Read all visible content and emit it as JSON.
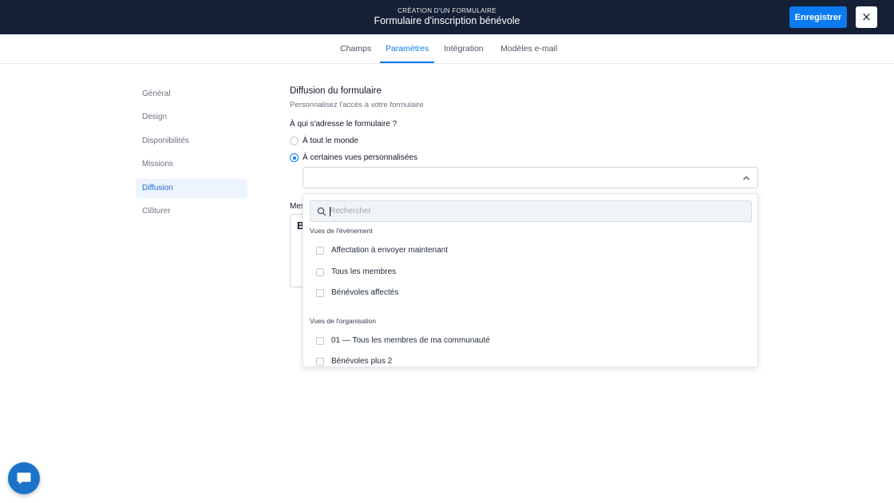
{
  "header": {
    "supertitle": "CRÉATION D'UN FORMULAIRE",
    "title": "Formulaire d'inscription bénévole",
    "save_label": "Enregistrer",
    "close_icon": "×",
    "bg_color": "#152036",
    "accent": "#0b7bf1"
  },
  "tabs": [
    {
      "label": "Champs",
      "active": false
    },
    {
      "label": "Paramètres",
      "active": true
    },
    {
      "label": "Intégration",
      "active": false
    },
    {
      "label": "Modèles e-mail",
      "active": false
    }
  ],
  "sidebar": {
    "items": [
      {
        "label": "Général",
        "active": false
      },
      {
        "label": "Design",
        "active": false
      },
      {
        "label": "Disponibilités",
        "active": false
      },
      {
        "label": "Missions",
        "active": false
      },
      {
        "label": "Diffusion",
        "active": true
      },
      {
        "label": "Clôturer",
        "active": false
      }
    ]
  },
  "section": {
    "title": "Diffusion du formulaire",
    "subtitle": "Personnalisez l'accès à votre formulaire",
    "question": "À qui s'adresse le formulaire ?",
    "options": [
      {
        "label": "À tout le monde",
        "checked": false
      },
      {
        "label": "À certaines vues personnalisées",
        "checked": true
      }
    ],
    "partial_label_behind": "Mes",
    "partial_editor_glyph": "B"
  },
  "dropdown": {
    "search_placeholder": "Rechercher",
    "groups": [
      {
        "title": "Vues de l'événement",
        "items": [
          "Affectation à envoyer maintenant",
          "Tous les membres",
          "Bénévoles affectés"
        ]
      },
      {
        "title": "Vues de l'organisation",
        "items": [
          "01 — Tous les membres de ma communauté",
          "Bénévoles plus 2"
        ]
      }
    ]
  },
  "chat": {
    "icon": "chat-bubble-icon"
  }
}
